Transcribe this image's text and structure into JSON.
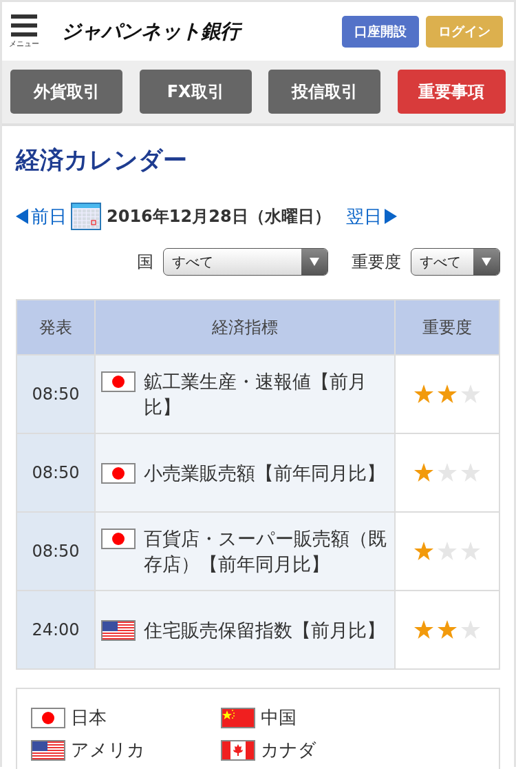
{
  "header": {
    "menu_label": "メニュー",
    "logo": "ジャパンネット銀行",
    "buttons": [
      {
        "label": "口座開設",
        "kind": "primary"
      },
      {
        "label": "ログイン",
        "kind": "login"
      }
    ]
  },
  "nav": [
    {
      "label": "外貨取引",
      "kind": "normal"
    },
    {
      "label": "FX取引",
      "kind": "normal"
    },
    {
      "label": "投信取引",
      "kind": "normal"
    },
    {
      "label": "重要事項",
      "kind": "alert"
    }
  ],
  "title": "経済カレンダー",
  "date_nav": {
    "prev": "前日",
    "date": "2016年12月28日（水曜日）",
    "next": "翌日"
  },
  "filters": [
    {
      "label": "国",
      "value": "すべて"
    },
    {
      "label": "重要度",
      "value": "すべて"
    }
  ],
  "table": {
    "columns": [
      "発表",
      "経済指標",
      "重要度"
    ],
    "rows": [
      {
        "time": "08:50",
        "kind": "jp",
        "indicator": "鉱工業生産・速報値【前月比】",
        "stars": 2
      },
      {
        "time": "08:50",
        "kind": "jp",
        "indicator": "小売業販売額【前年同月比】",
        "stars": 1
      },
      {
        "time": "08:50",
        "kind": "jp",
        "indicator": "百貨店・スーパー販売額（既存店）【前年同月比】",
        "stars": 1
      },
      {
        "time": "24:00",
        "kind": "us",
        "indicator": "住宅販売保留指数【前月比】",
        "stars": 2
      }
    ]
  },
  "legend": [
    {
      "kind": "jp",
      "label": "日本"
    },
    {
      "kind": "cn",
      "label": "中国"
    },
    {
      "kind": "us",
      "label": "アメリカ"
    },
    {
      "kind": "ca",
      "label": "カナダ"
    }
  ]
}
